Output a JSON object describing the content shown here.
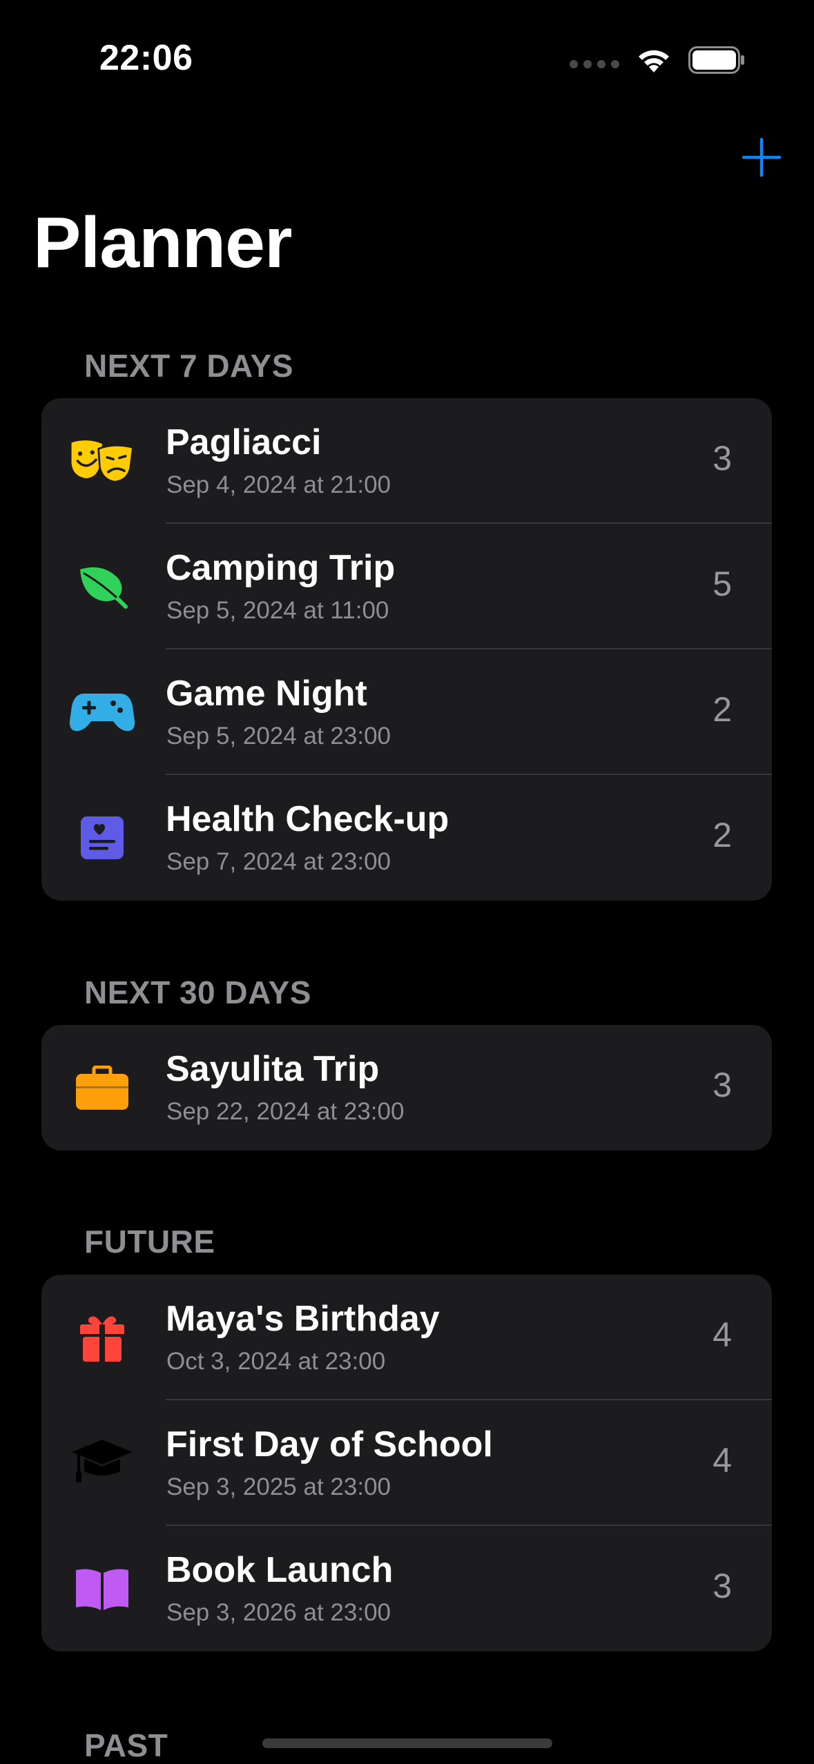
{
  "status_bar": {
    "time": "22:06"
  },
  "header": {
    "title": "Planner"
  },
  "colors": {
    "accent": "#0a84ff",
    "background": "#000000",
    "card": "#1c1c1e",
    "secondary_text": "#8e8e93"
  },
  "sections": [
    {
      "header": "NEXT 7 DAYS",
      "items": [
        {
          "title": "Pagliacci",
          "date": "Sep 4, 2024 at 21:00",
          "count": "3",
          "icon": "theater-masks-icon"
        },
        {
          "title": "Camping Trip",
          "date": "Sep 5, 2024 at 11:00",
          "count": "5",
          "icon": "leaf-icon"
        },
        {
          "title": "Game Night",
          "date": "Sep 5, 2024 at 23:00",
          "count": "2",
          "icon": "gamecontroller-icon"
        },
        {
          "title": "Health Check-up",
          "date": "Sep 7, 2024 at 23:00",
          "count": "2",
          "icon": "medical-record-icon"
        }
      ]
    },
    {
      "header": "NEXT 30 DAYS",
      "items": [
        {
          "title": "Sayulita Trip",
          "date": "Sep 22, 2024 at 23:00",
          "count": "3",
          "icon": "suitcase-icon"
        }
      ]
    },
    {
      "header": "FUTURE",
      "items": [
        {
          "title": "Maya's Birthday",
          "date": "Oct 3, 2024 at 23:00",
          "count": "4",
          "icon": "gift-icon"
        },
        {
          "title": "First Day of School",
          "date": "Sep 3, 2025 at 23:00",
          "count": "4",
          "icon": "graduation-cap-icon"
        },
        {
          "title": "Book Launch",
          "date": "Sep 3, 2026 at 23:00",
          "count": "3",
          "icon": "book-icon"
        }
      ]
    },
    {
      "header": "PAST",
      "items": []
    }
  ]
}
